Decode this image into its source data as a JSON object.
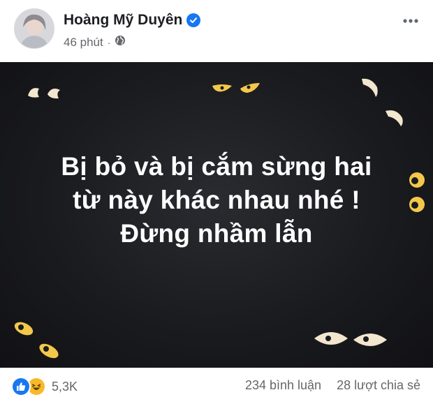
{
  "post": {
    "author": "Hoàng Mỹ Duyên",
    "time": "46 phút",
    "separator": "·",
    "privacy_icon": "globe-icon",
    "verified_icon": "verified-badge-icon",
    "more_icon": "more-horizontal-icon"
  },
  "image": {
    "lines": [
      "Bị bỏ và bị cắm sừng hai",
      "từ này khác nhau nhé !",
      "Đừng nhầm lẫn"
    ]
  },
  "footer": {
    "reaction_icons": [
      "like-icon",
      "haha-icon"
    ],
    "reaction_count": "5,3K",
    "comments": "234 bình luận",
    "shares": "28 lượt chia sẻ"
  },
  "colors": {
    "accent": "#1877f2",
    "text_primary": "#1c1e21",
    "text_secondary": "#65676b",
    "image_bg": "#1a1b1f",
    "haha": "#f7b928"
  }
}
